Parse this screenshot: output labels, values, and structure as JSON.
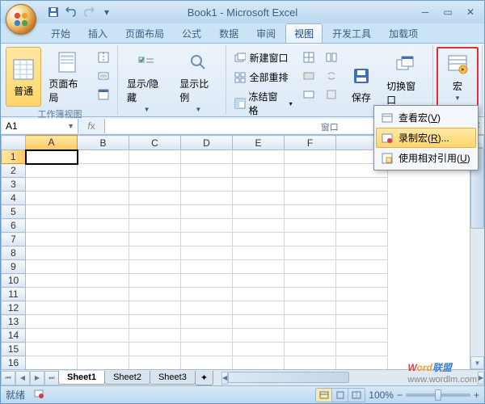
{
  "title": "Book1 - Microsoft Excel",
  "tabs": [
    "开始",
    "插入",
    "页面布局",
    "公式",
    "数据",
    "审阅",
    "视图",
    "开发工具",
    "加载项"
  ],
  "activeTab": 6,
  "ribbon": {
    "group1": {
      "label": "工作簿视图",
      "normal": "普通",
      "pageLayout": "页面布局"
    },
    "group2": {
      "showHide": "显示/隐藏",
      "zoom": "显示比例"
    },
    "group3": {
      "label": "窗口",
      "newWindow": "新建窗口",
      "arrange": "全部重排",
      "freeze": "冻结窗格",
      "save": "保存",
      "switch": "切换窗口"
    },
    "group4": {
      "macros": "宏"
    }
  },
  "macroMenu": {
    "view": "查看宏(",
    "viewKey": "V",
    "viewEnd": ")",
    "record": "录制宏(",
    "recordKey": "R",
    "recordEnd": ")...",
    "relative": "使用相对引用(",
    "relativeKey": "U",
    "relativeEnd": ")"
  },
  "nameBox": "A1",
  "columns": [
    "A",
    "B",
    "C",
    "D",
    "E",
    "F"
  ],
  "rows": [
    "1",
    "2",
    "3",
    "4",
    "5",
    "6",
    "7",
    "8",
    "9",
    "10",
    "11",
    "12",
    "13",
    "14",
    "15",
    "16"
  ],
  "sheetTabs": [
    "Sheet1",
    "Sheet2",
    "Sheet3"
  ],
  "status": "就绪",
  "zoom": "100%",
  "watermark": {
    "w": "W",
    "ord": "ord",
    "lm": "联盟",
    "url": "www.wordlm.com"
  }
}
